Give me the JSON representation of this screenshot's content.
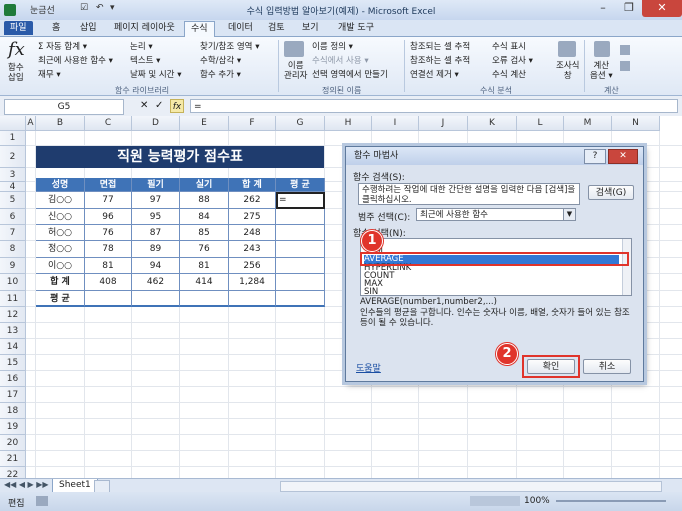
{
  "window": {
    "title": "수식 입력방법 알아보기(예제) - Microsoft Excel",
    "quick_access": [
      "눈금선",
      "☑",
      "↶",
      "▾"
    ],
    "minimize": "–",
    "restore": "❐",
    "close": "✕"
  },
  "tabs": [
    "파일",
    "홈",
    "삽입",
    "페이지 레이아웃",
    "수식",
    "데이터",
    "검토",
    "보기",
    "개발 도구"
  ],
  "active_tab": "수식",
  "ribbon": {
    "insert_function": "함수\n삽입",
    "lib_col1": [
      "Σ 자동 합계 ▾",
      "최근에 사용한 함수 ▾",
      "재무 ▾"
    ],
    "lib_col2": [
      "논리 ▾",
      "텍스트 ▾",
      "날짜 및 시간 ▾"
    ],
    "lib_col3": [
      "찾기/참조 영역 ▾",
      "수학/삼각 ▾",
      "함수 추가 ▾"
    ],
    "group_library": "함수 라이브러리",
    "name_manager": "이름\n관리자",
    "names_col": [
      "이름 정의 ▾",
      "수식에서 사용 ▾",
      "선택 영역에서 만들기"
    ],
    "group_names": "정의된 이름",
    "audit_col1": [
      "참조되는 셀 추적",
      "참조하는 셀 추적",
      "연결선 제거 ▾"
    ],
    "audit_col2": [
      "수식 표시",
      "오류 검사 ▾",
      "수식 계산"
    ],
    "watch": "조사식\n창",
    "group_audit": "수식 분석",
    "calc_options": "계산\n옵션 ▾",
    "group_calc": "계산"
  },
  "formula_bar": {
    "name_box": "G5",
    "formula": "="
  },
  "columns": [
    "A",
    "B",
    "C",
    "D",
    "E",
    "F",
    "G",
    "H",
    "I",
    "J",
    "K",
    "L",
    "M",
    "N"
  ],
  "rows": [
    "1",
    "2",
    "3",
    "4",
    "5",
    "6",
    "7",
    "8",
    "9",
    "10",
    "11",
    "12",
    "13",
    "14",
    "15",
    "16",
    "17",
    "18",
    "19",
    "20",
    "21",
    "22",
    "23"
  ],
  "sheet": {
    "title": "직원 능력평가 점수표",
    "headers": [
      "성명",
      "면접",
      "필기",
      "실기",
      "합 계",
      "평 균"
    ],
    "data": [
      [
        "김○○",
        "77",
        "97",
        "88",
        "262",
        "="
      ],
      [
        "신○○",
        "96",
        "95",
        "84",
        "275",
        ""
      ],
      [
        "허○○",
        "76",
        "87",
        "85",
        "248",
        ""
      ],
      [
        "정○○",
        "78",
        "89",
        "76",
        "243",
        ""
      ],
      [
        "이○○",
        "81",
        "94",
        "81",
        "256",
        ""
      ]
    ],
    "total_row": [
      "합 계",
      "408",
      "462",
      "414",
      "1,284",
      ""
    ],
    "avg_row": [
      "평 균",
      "",
      "",
      "",
      "",
      ""
    ]
  },
  "sheet_tab": "Sheet1",
  "status": {
    "mode": "편집",
    "zoom": "100%"
  },
  "dialog": {
    "title": "함수 마법사",
    "help_btn": "?",
    "close_btn": "✕",
    "search_label": "함수 검색(S):",
    "search_text": "수행하려는 작업에 대한 간단한 설명을 입력한 다음 [검색]을 클릭하십시오.",
    "search_btn": "검색(G)",
    "category_label": "범주 선택(C):",
    "category_value": "최근에 사용한 함수",
    "list_label": "함수 선택(N):",
    "functions": [
      "IF",
      "SUM",
      "AVERAGE",
      "HYPERLINK",
      "COUNT",
      "MAX",
      "SIN"
    ],
    "selected": "AVERAGE",
    "syntax": "AVERAGE(number1,number2,...)",
    "description": "인수들의 평균을 구합니다. 인수는 숫자나 이름, 배열, 숫자가 들어 있는 참조 등이 될 수 있습니다.",
    "help_link": "도움말",
    "ok_btn": "확인",
    "cancel_btn": "취소"
  },
  "badges": [
    "1",
    "2"
  ]
}
